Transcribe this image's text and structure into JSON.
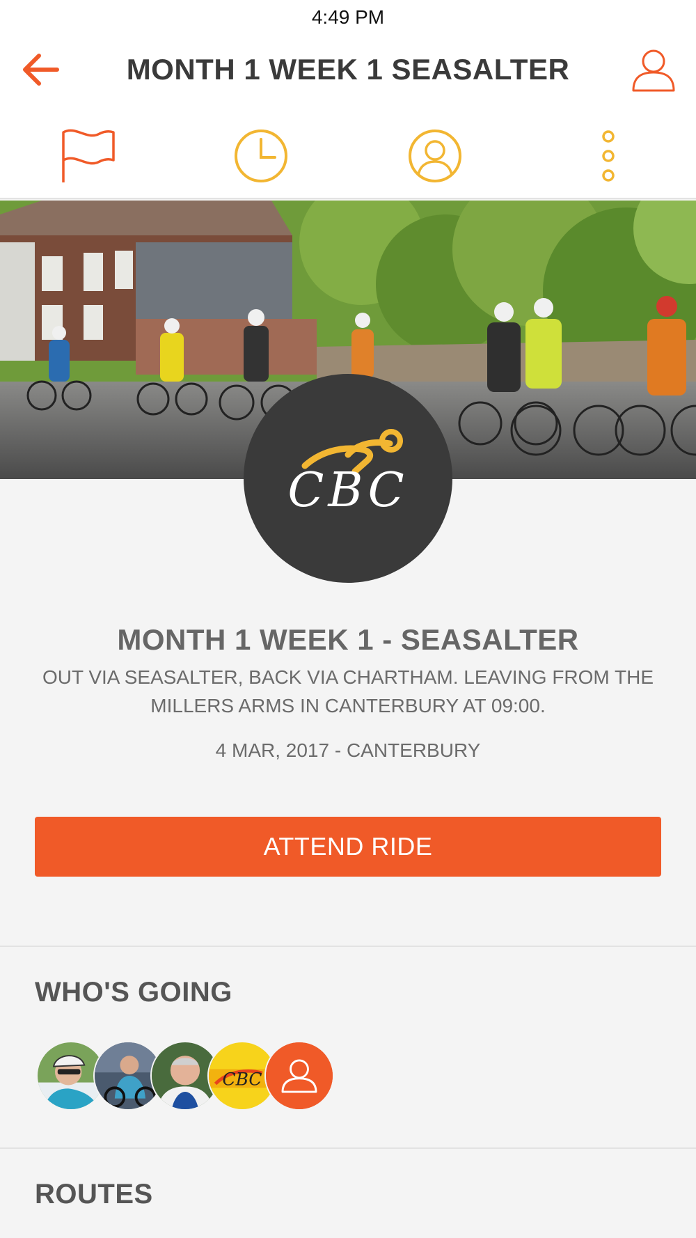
{
  "status_bar": {
    "time": "4:49 PM"
  },
  "nav": {
    "back_icon": "arrow-left-icon",
    "title": "MONTH 1 WEEK 1   SEASALTER",
    "profile_icon": "user-icon"
  },
  "tabs": [
    {
      "icon": "flag-icon",
      "color": "#f05a28"
    },
    {
      "icon": "clock-icon",
      "color": "#f2b632"
    },
    {
      "icon": "user-circle-icon",
      "color": "#f2b632"
    },
    {
      "icon": "more-vertical-icon",
      "color": "#f2b632"
    }
  ],
  "club": {
    "logo_text": "CBC"
  },
  "ride": {
    "title": "MONTH 1 WEEK 1 - SEASALTER",
    "description": "OUT VIA SEASALTER, BACK VIA CHARTHAM. LEAVING FROM THE MILLERS ARMS IN CANTERBURY AT 09:00.",
    "date_location": "4 MAR, 2017 - CANTERBURY",
    "attend_label": "ATTEND RIDE"
  },
  "whos_going": {
    "heading": "WHO'S GOING",
    "more_icon": "user-icon"
  },
  "routes": {
    "heading": "ROUTES"
  },
  "colors": {
    "accent": "#f05a28",
    "secondary": "#f2b632",
    "logo_bg": "#3a3a3a"
  }
}
